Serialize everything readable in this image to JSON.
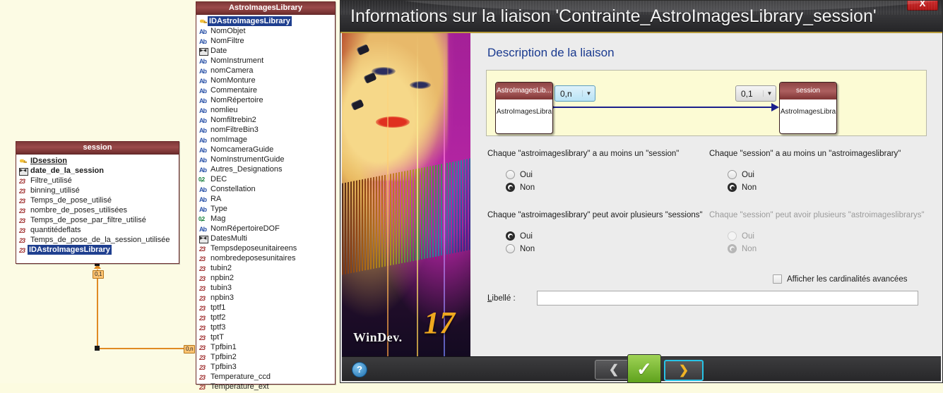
{
  "canvas": {
    "tables": [
      {
        "name": "session",
        "fields": [
          {
            "label": "IDsession",
            "type": "key",
            "style": "key"
          },
          {
            "label": "date_de_la_session",
            "type": "date",
            "style": "bold"
          },
          {
            "label": "Filtre_utilisé",
            "type": "real",
            "style": ""
          },
          {
            "label": "binning_utilisé",
            "type": "real",
            "style": ""
          },
          {
            "label": "Temps_de_pose_utilisé",
            "type": "real",
            "style": ""
          },
          {
            "label": "nombre_de_poses_utilisées",
            "type": "real",
            "style": ""
          },
          {
            "label": "Temps_de_pose_par_filtre_utilisé",
            "type": "real",
            "style": ""
          },
          {
            "label": "quantitédeflats",
            "type": "real",
            "style": ""
          },
          {
            "label": "Temps_de_pose_de_la_session_utilisée",
            "type": "real",
            "style": ""
          },
          {
            "label": "IDAstroImagesLibrary",
            "type": "real",
            "style": "sel"
          }
        ]
      },
      {
        "name": "AstroImagesLibrary",
        "fields": [
          {
            "label": "IDAstroImagesLibrary",
            "type": "key",
            "style": "sel-key"
          },
          {
            "label": "NomObjet",
            "type": "txt",
            "style": ""
          },
          {
            "label": "NomFiltre",
            "type": "txt",
            "style": ""
          },
          {
            "label": "Date",
            "type": "date",
            "style": ""
          },
          {
            "label": "NomInstrument",
            "type": "txt",
            "style": ""
          },
          {
            "label": "nomCamera",
            "type": "txt",
            "style": ""
          },
          {
            "label": "NomMonture",
            "type": "txt",
            "style": ""
          },
          {
            "label": "Commentaire",
            "type": "txt",
            "style": ""
          },
          {
            "label": "NomRépertoire",
            "type": "txt",
            "style": ""
          },
          {
            "label": "nomlieu",
            "type": "txt",
            "style": ""
          },
          {
            "label": "Nomfiltrebin2",
            "type": "txt",
            "style": ""
          },
          {
            "label": "nomFiltreBin3",
            "type": "txt",
            "style": ""
          },
          {
            "label": "nomImage",
            "type": "txt",
            "style": ""
          },
          {
            "label": "NomcameraGuide",
            "type": "txt",
            "style": ""
          },
          {
            "label": "NomInstrumentGuide",
            "type": "txt",
            "style": ""
          },
          {
            "label": "Autres_Designations",
            "type": "txt",
            "style": ""
          },
          {
            "label": "DEC",
            "type": "num",
            "style": ""
          },
          {
            "label": "Constellation",
            "type": "txt",
            "style": ""
          },
          {
            "label": "RA",
            "type": "txt",
            "style": ""
          },
          {
            "label": "Type",
            "type": "txt",
            "style": ""
          },
          {
            "label": "Mag",
            "type": "num",
            "style": ""
          },
          {
            "label": "NomRépertoireDOF",
            "type": "txt",
            "style": ""
          },
          {
            "label": "DatesMulti",
            "type": "date",
            "style": ""
          },
          {
            "label": "Tempsdeposeunitaireens",
            "type": "real",
            "style": ""
          },
          {
            "label": "nombredeposesunitaires",
            "type": "real",
            "style": ""
          },
          {
            "label": "tubin2",
            "type": "real",
            "style": ""
          },
          {
            "label": "npbin2",
            "type": "real",
            "style": ""
          },
          {
            "label": "tubin3",
            "type": "real",
            "style": ""
          },
          {
            "label": "npbin3",
            "type": "real",
            "style": ""
          },
          {
            "label": "tptf1",
            "type": "real",
            "style": ""
          },
          {
            "label": "tptf2",
            "type": "real",
            "style": ""
          },
          {
            "label": "tptf3",
            "type": "real",
            "style": ""
          },
          {
            "label": "tptT",
            "type": "real",
            "style": ""
          },
          {
            "label": "Tpfbin1",
            "type": "real",
            "style": ""
          },
          {
            "label": "Tpfbin2",
            "type": "real",
            "style": ""
          },
          {
            "label": "Tpfbin3",
            "type": "real",
            "style": ""
          },
          {
            "label": "Temperature_ccd",
            "type": "real",
            "style": ""
          },
          {
            "label": "Temperature_ext",
            "type": "real",
            "style": ""
          }
        ]
      }
    ],
    "link_cardinality_top": "0,1",
    "link_cardinality_bottom": "0,n"
  },
  "dialog": {
    "title": "Informations sur la liaison 'Contrainte_AstroImagesLibrary_session'",
    "close_label": "X",
    "section_title": "Description de la liaison",
    "promo": {
      "brand": "WinDev.",
      "version": "17"
    },
    "diagram": {
      "left_node_header": "AstroImagesLib...",
      "left_node_field": "AstroImagesLibra",
      "right_node_header": "session",
      "right_node_field": "AstroImagesLibra",
      "left_cardinality": "0,n",
      "right_cardinality": "0,1",
      "dropdown_arrow": "▼"
    },
    "questions": [
      {
        "id": "q1",
        "text": "Chaque \"astroimageslibrary\" a au moins un \"session\"",
        "enabled": true,
        "options": [
          {
            "label": "Oui",
            "selected": false
          },
          {
            "label": "Non",
            "selected": true
          }
        ]
      },
      {
        "id": "q2",
        "text": "Chaque \"session\" a au moins un \"astroimageslibrary\"",
        "enabled": true,
        "options": [
          {
            "label": "Oui",
            "selected": false
          },
          {
            "label": "Non",
            "selected": true
          }
        ]
      },
      {
        "id": "q3",
        "text": "Chaque \"astroimageslibrary\" peut avoir plusieurs \"sessions\"",
        "enabled": true,
        "options": [
          {
            "label": "Oui",
            "selected": true
          },
          {
            "label": "Non",
            "selected": false
          }
        ]
      },
      {
        "id": "q4",
        "text": "Chaque \"session\" peut avoir plusieurs \"astroimageslibrarys\"",
        "enabled": false,
        "options": [
          {
            "label": "Oui",
            "selected": false
          },
          {
            "label": "Non",
            "selected": true
          }
        ]
      }
    ],
    "advanced_checkbox": {
      "label": "Afficher les cardinalités avancées",
      "checked": false
    },
    "libelle": {
      "label_prefix": "L",
      "label_rest": "ibellé :",
      "value": "",
      "placeholder": ""
    },
    "footer": {
      "help_label": "?",
      "prev_label": "❮",
      "ok_label": "✓",
      "next_label": "❯"
    }
  },
  "colors": {
    "canvas_bg": "#fcfbe4",
    "link": "#e08a23",
    "table_header": "#8d4545",
    "accent_blue": "#1a3a8f",
    "relation_line": "#1b1f8c",
    "title_underline": "#b79b3c",
    "ok_green": "#5a9e18",
    "next_cyan": "#28c3e6"
  }
}
